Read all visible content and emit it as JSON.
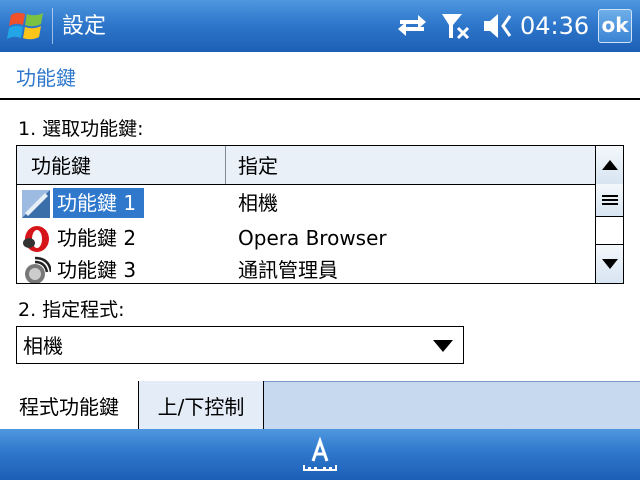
{
  "titlebar": {
    "title": "設定",
    "time": "04:36",
    "ok_label": "ok",
    "icons": [
      "windows-start-icon",
      "connectivity-arrows-icon",
      "signal-off-icon",
      "speaker-icon"
    ]
  },
  "page": {
    "heading": "功能鍵"
  },
  "section1": {
    "label": "1. 選取功能鍵:"
  },
  "list": {
    "columns": [
      "功能鍵",
      "指定"
    ],
    "rows": [
      {
        "name": "功能鍵 1",
        "assigned": "相機",
        "icon": "camera-icon",
        "selected": true
      },
      {
        "name": "功能鍵 2",
        "assigned": "Opera Browser",
        "icon": "opera-icon",
        "selected": false
      },
      {
        "name": "功能鍵 3",
        "assigned": "通訊管理員",
        "icon": "comm-manager-icon",
        "selected": false
      }
    ]
  },
  "section2": {
    "label": "2. 指定程式:"
  },
  "dropdown": {
    "value": "相機"
  },
  "tabs": [
    {
      "label": "程式功能鍵",
      "active": true
    },
    {
      "label": "上/下控制",
      "active": false
    }
  ],
  "softkeys": {
    "sip_icon": "keyboard-input-icon"
  },
  "colors": {
    "accent": "#2f78cc",
    "titlebar": "#2f78cc",
    "tab_strip": "#c6d9ee"
  }
}
